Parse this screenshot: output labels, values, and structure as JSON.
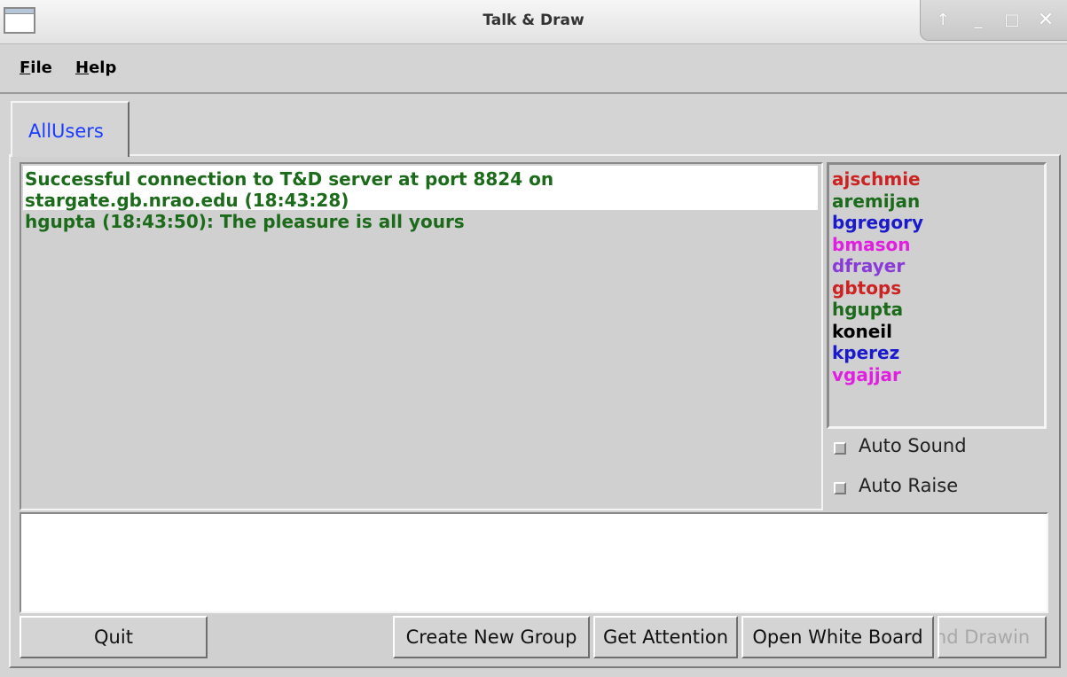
{
  "window": {
    "title": "Talk & Draw",
    "controls": {
      "up": "↑",
      "minimize": "_",
      "maximize": "□",
      "close": "✕"
    }
  },
  "menu": {
    "file": "File",
    "help": "Help"
  },
  "tabs": [
    {
      "label": "AllUsers",
      "color": "#1a3cff"
    }
  ],
  "chat": {
    "lines": [
      "Successful connection to T&D server at port 8824 on",
      "stargate.gb.nrao.edu (18:43:28)",
      "hgupta (18:43:50): The pleasure is all yours"
    ],
    "text_color": "#1b6b1b"
  },
  "users": [
    {
      "name": "ajschmie",
      "color": "#cc2222"
    },
    {
      "name": "aremijan",
      "color": "#1b6b1b"
    },
    {
      "name": "bgregory",
      "color": "#1a1acc"
    },
    {
      "name": "bmason",
      "color": "#e020e0"
    },
    {
      "name": "dfrayer",
      "color": "#8a3ad6"
    },
    {
      "name": "gbtops",
      "color": "#cc2222"
    },
    {
      "name": "hgupta",
      "color": "#1b6b1b"
    },
    {
      "name": "koneil",
      "color": "#000000"
    },
    {
      "name": "kperez",
      "color": "#1a1acc"
    },
    {
      "name": "vgajjar",
      "color": "#e020e0"
    }
  ],
  "options": {
    "auto_sound": "Auto Sound",
    "auto_raise": "Auto Raise"
  },
  "input": {
    "value": ""
  },
  "buttons": {
    "quit": "Quit",
    "create_group": "Create New Group",
    "get_attention": "Get Attention",
    "open_whiteboard": "Open White Board",
    "send_drawing": "end Drawin"
  }
}
